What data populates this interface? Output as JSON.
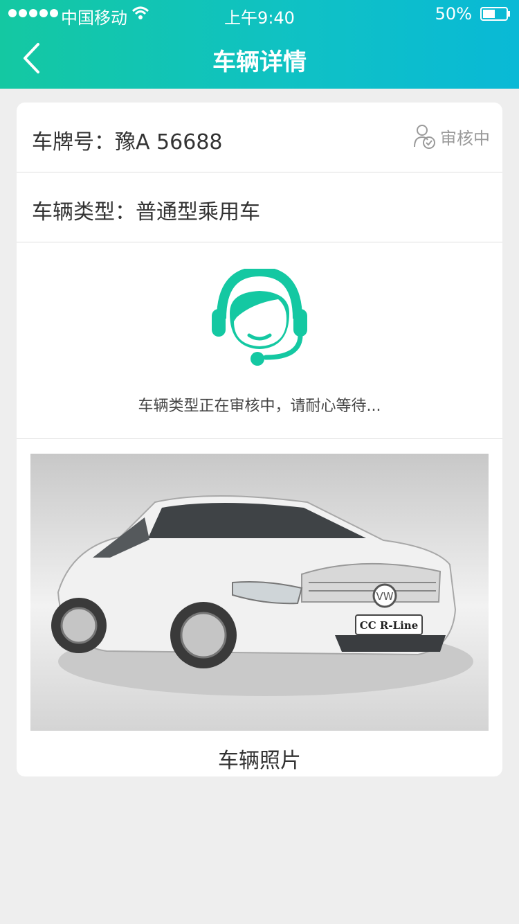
{
  "status_bar": {
    "carrier": "中国移动",
    "time": "上午9:40",
    "battery": "50%"
  },
  "nav": {
    "title": "车辆详情"
  },
  "vehicle": {
    "plate_label": "车牌号：豫A 56688",
    "type_label": "车辆类型：普通型乘用车",
    "status": "审核中",
    "review_message": "车辆类型正在审核中，请耐心等待...",
    "photo_caption": "车辆照片",
    "photo_badge": "CC R-Line"
  },
  "colors": {
    "accent": "#14c8a2",
    "header_end": "#09b9d6",
    "page_bg": "#eeeeee"
  },
  "icons": [
    "back-icon",
    "wifi-icon",
    "battery-icon",
    "review-status-icon",
    "customer-service-icon"
  ]
}
